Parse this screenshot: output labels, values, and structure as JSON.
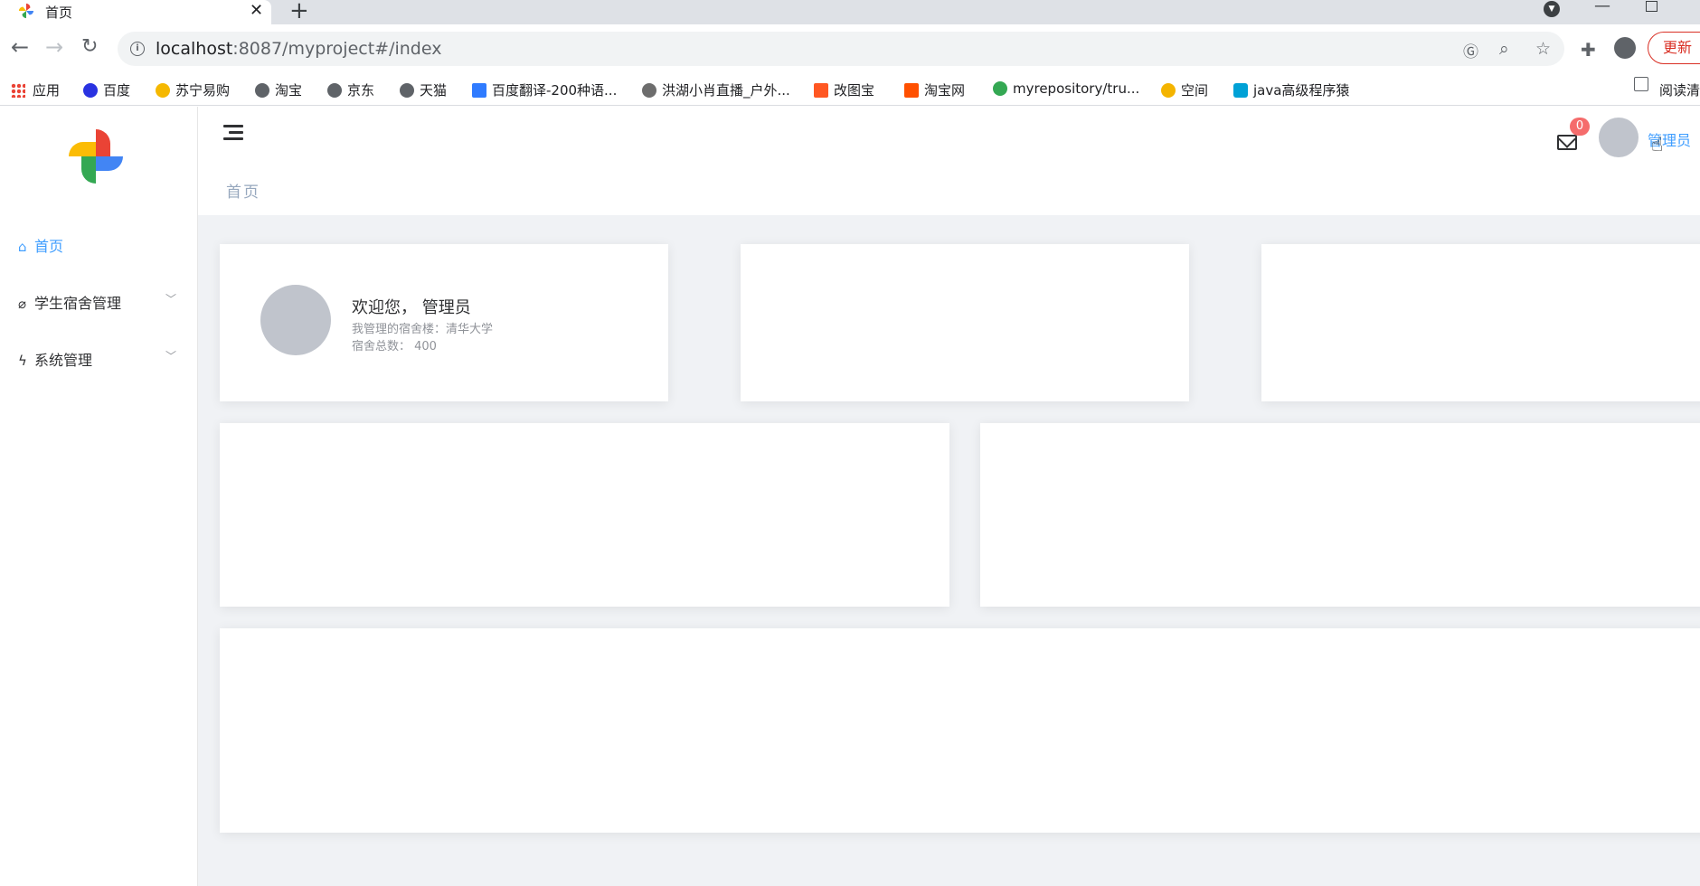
{
  "browser": {
    "tab_title": "首页",
    "tab_close": "✕",
    "new_tab": "+",
    "url_host": "localhost",
    "url_rest": ":8087/myproject#/index",
    "update_label": "更新",
    "bookmarks": [
      {
        "label": "应用",
        "icon": "apps-icon",
        "color": "#ea4335"
      },
      {
        "label": "百度",
        "icon": "baidu-icon",
        "color": "#2932e1"
      },
      {
        "label": "苏宁易购",
        "icon": "suning-icon",
        "color": "#f5b800"
      },
      {
        "label": "淘宝",
        "icon": "globe-icon",
        "color": "#5f6368"
      },
      {
        "label": "京东",
        "icon": "globe-icon",
        "color": "#5f6368"
      },
      {
        "label": "天猫",
        "icon": "globe-icon",
        "color": "#5f6368"
      },
      {
        "label": "百度翻译-200种语...",
        "icon": "baidu-translate-icon",
        "color": "#2f7bff"
      },
      {
        "label": "洪湖小肖直播_户外...",
        "icon": "feather-icon",
        "color": "#6d6d6d"
      },
      {
        "label": "改图宝",
        "icon": "gaitubao-icon",
        "color": "#ff5722"
      },
      {
        "label": "淘宝网",
        "icon": "taobao-icon",
        "color": "#ff5000"
      },
      {
        "label": "myrepository/tru...",
        "icon": "chrome-icon",
        "color": "#34a853"
      },
      {
        "label": "空间",
        "icon": "qzone-icon",
        "color": "#f4b400"
      },
      {
        "label": "java高级程序猿",
        "icon": "bilibili-icon",
        "color": "#00a1d6"
      }
    ],
    "reading_list": "阅读清"
  },
  "sidebar": {
    "items": [
      {
        "label": "首页",
        "icon": "home-icon",
        "glyph": "⌂",
        "active": true
      },
      {
        "label": "学生宿舍管理",
        "icon": "paperclip-icon",
        "glyph": "⌀",
        "active": false,
        "expandable": true
      },
      {
        "label": "系统管理",
        "icon": "lightning-icon",
        "glyph": "ϟ",
        "active": false,
        "expandable": true
      }
    ],
    "accent_color": "#409eff"
  },
  "header": {
    "breadcrumb": "首页",
    "mail_count": "0",
    "user_name": "管理员"
  },
  "welcome": {
    "title": "欢迎您， 管理员",
    "building": "我管理的宿舍楼：清华大学",
    "dorm_total": "宿舍总数： 400"
  }
}
